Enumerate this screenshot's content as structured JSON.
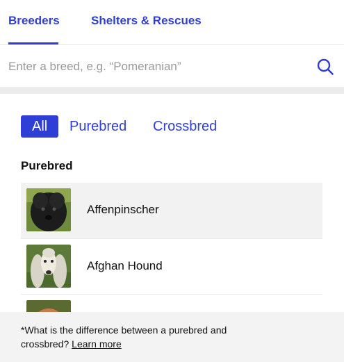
{
  "tabs": {
    "breeders": "Breeders",
    "shelters": "Shelters & Rescues"
  },
  "search": {
    "placeholder": "Enter a breed, e.g. “Pomeranian”",
    "icon": "search-icon"
  },
  "filters": {
    "all": "All",
    "purebred": "Purebred",
    "crossbred": "Crossbred"
  },
  "section": {
    "title": "Purebred"
  },
  "breeds": [
    {
      "name": "Affenpinscher"
    },
    {
      "name": "Afghan Hound"
    },
    {
      "name": ""
    }
  ],
  "footer": {
    "note": "*What is the difference between a purebred and crossbred?",
    "link": "Learn more"
  },
  "colors": {
    "accent": "#2f3fd6"
  }
}
